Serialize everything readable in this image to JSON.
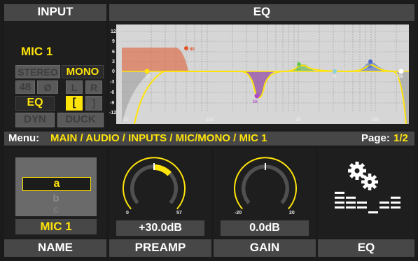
{
  "input_panel": {
    "title": "INPUT",
    "channel_name": "MIC 1",
    "buttons": {
      "stereo": "STEREO",
      "mono": "MONO",
      "phantom": "48",
      "phase": "Ø",
      "left": "L",
      "right": "R",
      "eq": "EQ",
      "bracket_open": "[",
      "bracket_close": "]",
      "dyn": "DYN",
      "duck": "DUCK"
    }
  },
  "eq_panel": {
    "title": "EQ",
    "y_ticks": [
      "12",
      "9",
      "6",
      "3",
      "0",
      "-3",
      "-6",
      "-9",
      "-12"
    ],
    "x_ticks": [
      "10",
      "100",
      "1k",
      "10k"
    ],
    "band_labels": [
      "25",
      "80",
      "1k",
      "1k",
      "5k",
      "3k",
      "15k"
    ]
  },
  "menu_bar": {
    "prefix": "Menu:",
    "path": "MAIN / AUDIO / INPUTS / MIC/MONO / MIC 1",
    "page_label": "Page:",
    "page_value": "1/2"
  },
  "name_cell": {
    "list_items": [
      "a",
      "b",
      "c"
    ],
    "selected_item": "a",
    "value": "MIC 1",
    "label": "NAME"
  },
  "preamp_cell": {
    "knob_min": "0",
    "knob_max": "57",
    "level": 0.53,
    "value": "+30.0dB",
    "label": "PREAMP"
  },
  "gain_cell": {
    "knob_min": "-20",
    "knob_max": "20",
    "level": 0.5,
    "value": "0.0dB",
    "label": "GAIN"
  },
  "eq_cell": {
    "icon": "gears-eq-icon",
    "label": "EQ"
  },
  "colors": {
    "accent": "#ffe40a",
    "panel_header": "#474747",
    "background": "#1b1b1b"
  }
}
